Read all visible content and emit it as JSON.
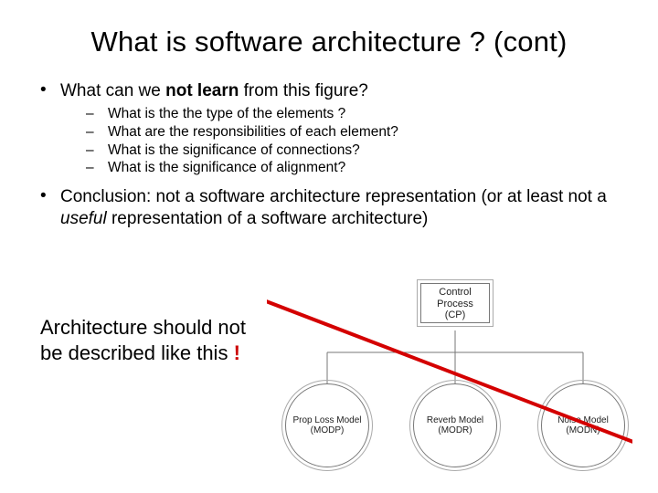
{
  "title": "What is software architecture ? (cont)",
  "bullets": {
    "b1_pre": "What  can we ",
    "b1_bold": "not learn",
    "b1_post": " from this figure?",
    "sub1": "What is the the  type of the elements ?",
    "sub2": "What are the responsibilities of each element?",
    "sub3": "What is the significance of connections?",
    "sub4": "What is the significance of alignment?",
    "b2_pre": "Conclusion: not a software architecture representation (or at least not a ",
    "b2_ital": "useful",
    "b2_post": " representation of a software architecture)"
  },
  "callout": {
    "line1": "Architecture should not",
    "line2": "be described like this ",
    "bang": "!"
  },
  "diagram": {
    "top_label1": "Control",
    "top_label2": "Process",
    "top_label3": "(CP)",
    "c1a": "Prop Loss Model",
    "c1b": "(MODP)",
    "c2a": "Reverb Model",
    "c2b": "(MODR)",
    "c3a": "Noise Model",
    "c3b": "(MODN)"
  }
}
